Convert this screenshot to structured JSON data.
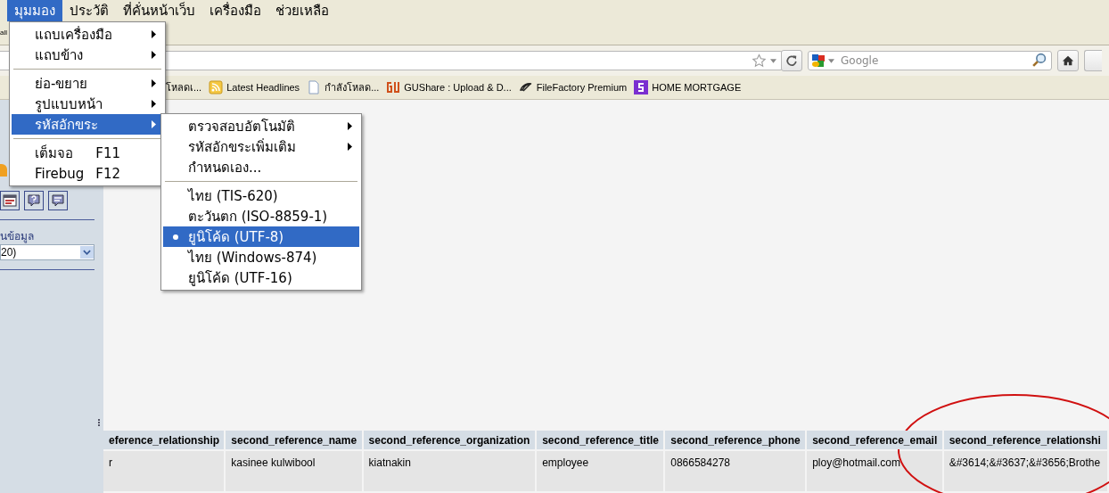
{
  "menu_bar": {
    "items": [
      {
        "label": "มุมมอง",
        "selected": true
      },
      {
        "label": "ประวัติ",
        "selected": false
      },
      {
        "label": "ที่คั่นหน้าเว็บ",
        "selected": false
      },
      {
        "label": "เครื่องมือ",
        "selected": false
      },
      {
        "label": "ช่วยเหลือ",
        "selected": false
      }
    ]
  },
  "toolbar_fragment": "all",
  "view_menu": {
    "groups": [
      [
        {
          "label": "แถบเครื่องมือ",
          "kind": "submenu",
          "selected": false
        },
        {
          "label": "แถบข้าง",
          "kind": "submenu",
          "selected": false
        }
      ],
      [
        {
          "label": "ย่อ-ขยาย",
          "kind": "submenu",
          "selected": false
        },
        {
          "label": "รูปแบบหน้า",
          "kind": "submenu",
          "selected": false
        },
        {
          "label": "รหัสอักขระ",
          "kind": "submenu",
          "selected": true
        }
      ],
      [
        {
          "label": "เต็มจอ",
          "kind": "shortcut",
          "shortcut": "F11",
          "selected": false
        },
        {
          "label": "Firebug",
          "kind": "shortcut",
          "shortcut": "F12",
          "selected": false
        }
      ]
    ]
  },
  "encoding_menu": {
    "groups": [
      [
        {
          "label": "ตรวจสอบอัตโนมัติ",
          "kind": "submenu",
          "checked": false,
          "selected": false
        },
        {
          "label": "รหัสอักขระเพิ่มเติม",
          "kind": "submenu",
          "checked": false,
          "selected": false
        },
        {
          "label": "กำหนดเอง...",
          "kind": "item",
          "checked": false,
          "selected": false
        }
      ],
      [
        {
          "label": "ไทย (TIS-620)",
          "kind": "item",
          "checked": false,
          "selected": false
        },
        {
          "label": "ตะวันตก (ISO-8859-1)",
          "kind": "item",
          "checked": false,
          "selected": false
        },
        {
          "label": "ยูนิโค้ด (UTF-8)",
          "kind": "item",
          "checked": true,
          "selected": true
        },
        {
          "label": "ไทย (Windows-874)",
          "kind": "item",
          "checked": false,
          "selected": false
        },
        {
          "label": "ยูนิโค้ด (UTF-16)",
          "kind": "item",
          "checked": false,
          "selected": false
        }
      ]
    ]
  },
  "search_field": {
    "placeholder": "Google"
  },
  "bookmarks": [
    {
      "label": "โหลดเ...",
      "kind": "none"
    },
    {
      "label": "Latest Headlines",
      "kind": "feed"
    },
    {
      "label": "กำลังโหลด...",
      "kind": "page"
    },
    {
      "label": "GUShare : Upload & D...",
      "kind": "gu"
    },
    {
      "label": "FileFactory Premium",
      "kind": "ff"
    },
    {
      "label": "HOME MORTGAGE",
      "kind": "s"
    }
  ],
  "sidebar": {
    "label": "นข้อมูล",
    "select_value": "20)"
  },
  "table": {
    "columns": [
      "eference_relationship",
      "second_reference_name",
      "second_reference_organization",
      "second_reference_title",
      "second_reference_phone",
      "second_reference_email",
      "second_reference_relationshi"
    ],
    "rows": [
      [
        "r",
        "kasinee kulwibool",
        "kiatnakin",
        "employee",
        "0866584278",
        "ploy@hotmail.com",
        "&#3614;&#3637;&#3656;Brothe"
      ]
    ]
  }
}
